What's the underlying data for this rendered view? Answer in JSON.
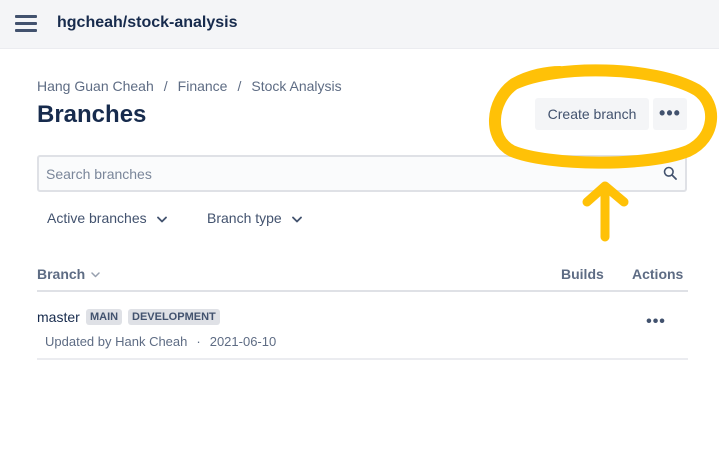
{
  "header": {
    "repo_title": "hgcheah/stock-analysis",
    "menu_icon": "hamburger-menu-icon"
  },
  "breadcrumb": [
    "Hang Guan Cheah",
    "Finance",
    "Stock Analysis"
  ],
  "page": {
    "title": "Branches"
  },
  "actions": {
    "create_branch_label": "Create branch",
    "more_label": "•••"
  },
  "search": {
    "placeholder": "Search branches",
    "value": ""
  },
  "filters": {
    "status_label": "Active branches",
    "type_label": "Branch type"
  },
  "table": {
    "columns": [
      "Branch",
      "Builds",
      "Actions"
    ],
    "rows": [
      {
        "name": "master",
        "badges": [
          "MAIN",
          "DEVELOPMENT"
        ],
        "updated_by": "Updated by Hank Cheah",
        "date": "2021-06-10",
        "separator": "·",
        "actions_label": "•••"
      }
    ]
  },
  "colors": {
    "annotation": "#ffc107",
    "primary_text": "#172b4d",
    "secondary_text": "#5e6c84"
  }
}
